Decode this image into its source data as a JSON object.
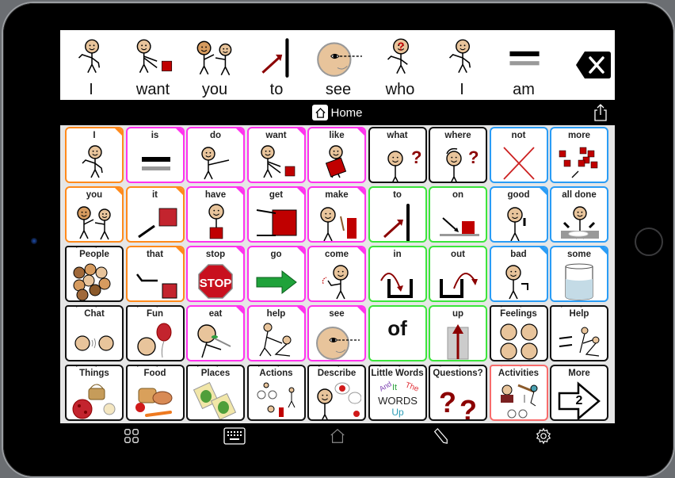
{
  "message_bar": {
    "words": [
      {
        "label": "I",
        "icon": "self-pointing-person-icon"
      },
      {
        "label": "want",
        "icon": "reaching-person-icon"
      },
      {
        "label": "you",
        "icon": "two-people-pointing-icon"
      },
      {
        "label": "to",
        "icon": "arrow-to-line-icon"
      },
      {
        "label": "see",
        "icon": "eye-face-icon"
      },
      {
        "label": "who",
        "icon": "question-person-icon"
      },
      {
        "label": "I",
        "icon": "self-pointing-person-icon"
      },
      {
        "label": "am",
        "icon": "equals-icon"
      }
    ],
    "clear_icon": "backspace-clear-icon"
  },
  "title_bar": {
    "title": "Home",
    "home_icon": "home-icon",
    "share_icon": "share-icon"
  },
  "colors": {
    "orange": "#ff8a1c",
    "magenta": "#ff33ee",
    "black": "#111111",
    "green": "#3ce53c",
    "blue": "#2a9cf5",
    "salmon": "#f76b6b",
    "symbol_red": "#c00000",
    "skin": "#e8c49b"
  },
  "grid": {
    "rows": [
      [
        {
          "label": "I",
          "border": "orange",
          "corner": "orange",
          "icon": "self-pointing-person-icon"
        },
        {
          "label": "is",
          "border": "magenta",
          "corner": "magenta",
          "icon": "equals-icon"
        },
        {
          "label": "do",
          "border": "magenta",
          "corner": "magenta",
          "icon": "person-doing-icon"
        },
        {
          "label": "want",
          "border": "magenta",
          "corner": "magenta",
          "icon": "reaching-person-icon"
        },
        {
          "label": "like",
          "border": "magenta",
          "corner": "magenta",
          "icon": "person-hugging-icon"
        },
        {
          "label": "what",
          "border": "black",
          "icon": "what-question-icon"
        },
        {
          "label": "where",
          "border": "black",
          "icon": "where-question-icon"
        },
        {
          "label": "not",
          "border": "blue",
          "icon": "red-x-icon"
        },
        {
          "label": "more",
          "border": "blue",
          "icon": "more-squares-icon"
        }
      ],
      [
        {
          "label": "you",
          "border": "orange",
          "corner": "orange",
          "icon": "two-people-pointing-icon"
        },
        {
          "label": "it",
          "border": "orange",
          "corner": "orange",
          "icon": "pointing-square-icon"
        },
        {
          "label": "have",
          "border": "magenta",
          "corner": "magenta",
          "icon": "person-holding-box-icon"
        },
        {
          "label": "get",
          "border": "magenta",
          "corner": "magenta",
          "icon": "hands-grab-box-icon"
        },
        {
          "label": "make",
          "border": "magenta",
          "corner": "magenta",
          "icon": "person-hammer-icon"
        },
        {
          "label": "to",
          "border": "green",
          "icon": "arrow-to-line-icon"
        },
        {
          "label": "on",
          "border": "green",
          "icon": "arrow-on-surface-icon"
        },
        {
          "label": "good",
          "border": "blue",
          "corner": "blue",
          "icon": "thumbs-up-person-icon"
        },
        {
          "label": "all done",
          "border": "blue",
          "icon": "all-done-plate-icon"
        }
      ],
      [
        {
          "label": "People",
          "border": "black",
          "folder": true,
          "icon": "group-of-faces-icon"
        },
        {
          "label": "that",
          "border": "orange",
          "corner": "orange",
          "icon": "pointing-far-square-icon"
        },
        {
          "label": "stop",
          "border": "magenta",
          "corner": "magenta",
          "icon": "stop-sign-icon"
        },
        {
          "label": "go",
          "border": "magenta",
          "corner": "magenta",
          "icon": "green-arrow-icon"
        },
        {
          "label": "come",
          "border": "magenta",
          "corner": "magenta",
          "icon": "person-beckon-icon"
        },
        {
          "label": "in",
          "border": "green",
          "icon": "arrow-into-box-icon"
        },
        {
          "label": "out",
          "border": "green",
          "icon": "arrow-out-box-icon"
        },
        {
          "label": "bad",
          "border": "blue",
          "corner": "blue",
          "icon": "thumbs-down-person-icon"
        },
        {
          "label": "some",
          "border": "blue",
          "corner": "blue",
          "icon": "glass-water-icon"
        }
      ],
      [
        {
          "label": "Chat",
          "border": "black",
          "folder": true,
          "icon": "two-faces-talking-icon"
        },
        {
          "label": "Fun",
          "border": "black",
          "folder": true,
          "icon": "face-balloon-icon"
        },
        {
          "label": "eat",
          "border": "magenta",
          "corner": "magenta",
          "icon": "person-eating-icon"
        },
        {
          "label": "help",
          "border": "magenta",
          "corner": "magenta",
          "icon": "person-helping-icon"
        },
        {
          "label": "see",
          "border": "magenta",
          "corner": "magenta",
          "icon": "eye-face-icon"
        },
        {
          "label": "",
          "border": "green",
          "text_symbol": "of",
          "icon": "text-of-icon"
        },
        {
          "label": "up",
          "border": "green",
          "icon": "arrow-up-icon"
        },
        {
          "label": "Feelings",
          "border": "black",
          "folder": true,
          "icon": "four-emotion-faces-icon"
        },
        {
          "label": "Help",
          "border": "black",
          "folder": true,
          "icon": "helping-hands-icon"
        }
      ],
      [
        {
          "label": "Things",
          "border": "black",
          "folder": true,
          "icon": "ball-basket-fan-icon"
        },
        {
          "label": "Food",
          "border": "black",
          "folder": true,
          "icon": "bread-apple-carrot-icon"
        },
        {
          "label": "Places",
          "border": "black",
          "folder": true,
          "icon": "maps-icon"
        },
        {
          "label": "Actions",
          "border": "black",
          "folder": true,
          "icon": "bike-walk-icon"
        },
        {
          "label": "Describe",
          "border": "black",
          "folder": true,
          "icon": "person-describing-icon"
        },
        {
          "label": "Little Words",
          "border": "black",
          "folder": true,
          "icon": "little-words-icon",
          "words": [
            "And",
            "It",
            "The",
            "WORDS",
            "Up"
          ]
        },
        {
          "label": "Questions?",
          "border": "black",
          "folder": true,
          "icon": "two-question-marks-icon"
        },
        {
          "label": "Activities",
          "border": "salmon",
          "folder": true,
          "icon": "activities-icon"
        },
        {
          "label": "More",
          "border": "black",
          "icon": "arrow-page-2-icon",
          "page": "2"
        }
      ]
    ]
  },
  "toolbar": {
    "items": [
      {
        "name": "grid-view-button",
        "icon": "grid-icon"
      },
      {
        "name": "keyboard-button",
        "icon": "keyboard-icon"
      },
      {
        "name": "home-button",
        "icon": "home-icon"
      },
      {
        "name": "edit-button",
        "icon": "pencil-icon"
      },
      {
        "name": "settings-button",
        "icon": "gear-icon"
      }
    ]
  }
}
